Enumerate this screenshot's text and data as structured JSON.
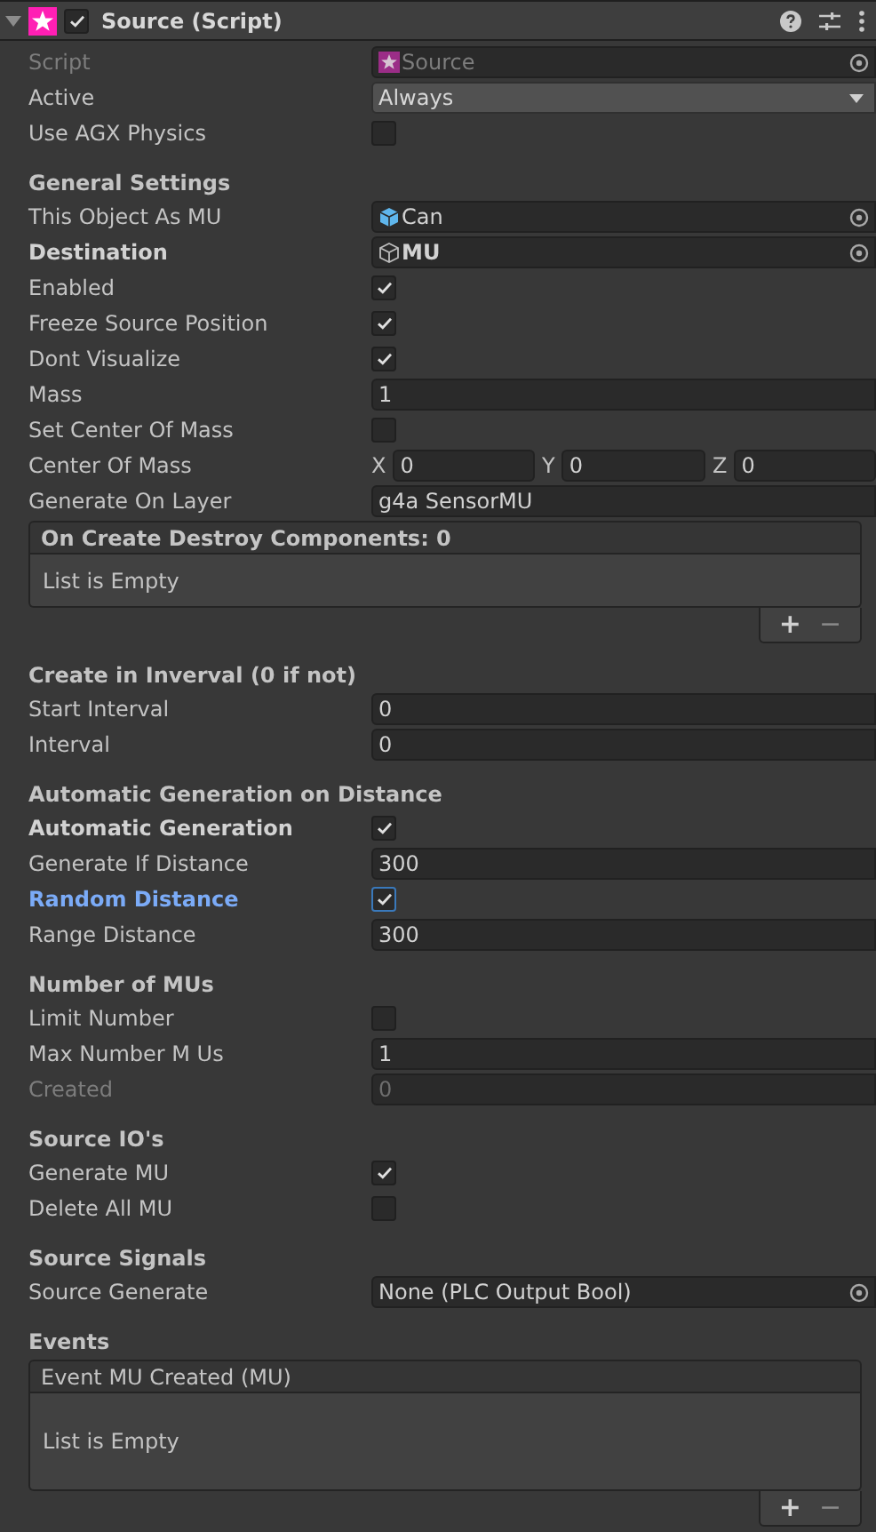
{
  "header": {
    "title": "Source (Script)",
    "expanded": true,
    "enabled": true
  },
  "groups": [
    {
      "rows": [
        {
          "kind": "script",
          "label": "Script",
          "disabled": true,
          "overridden": false,
          "focused": false,
          "value": "Source"
        },
        {
          "kind": "dropdown",
          "label": "Active",
          "disabled": false,
          "overridden": false,
          "focused": false,
          "value": "Always"
        },
        {
          "kind": "checkbox",
          "label": "Use AGX Physics",
          "disabled": false,
          "overridden": false,
          "focused": false,
          "checked": false
        }
      ]
    },
    {
      "heading": "General Settings",
      "rows": [
        {
          "kind": "prefab",
          "label": "This Object As MU",
          "disabled": false,
          "overridden": false,
          "focused": false,
          "value": "Can"
        },
        {
          "kind": "gameobject",
          "label": "Destination",
          "disabled": false,
          "overridden": true,
          "focused": false,
          "value": "MU"
        },
        {
          "kind": "checkbox",
          "label": "Enabled",
          "disabled": false,
          "overridden": false,
          "focused": false,
          "checked": true
        },
        {
          "kind": "checkbox",
          "label": "Freeze Source Position",
          "disabled": false,
          "overridden": false,
          "focused": false,
          "checked": true
        },
        {
          "kind": "checkbox",
          "label": "Dont Visualize",
          "disabled": false,
          "overridden": false,
          "focused": false,
          "checked": true
        },
        {
          "kind": "text",
          "label": "Mass",
          "disabled": false,
          "overridden": false,
          "focused": false,
          "value": "1"
        },
        {
          "kind": "checkbox",
          "label": "Set Center Of Mass",
          "disabled": false,
          "overridden": false,
          "focused": false,
          "checked": false
        },
        {
          "kind": "vector",
          "label": "Center Of Mass",
          "disabled": false,
          "overridden": false,
          "focused": false,
          "axes": [
            {
              "name": "X",
              "value": "0"
            },
            {
              "name": "Y",
              "value": "0"
            },
            {
              "name": "Z",
              "value": "0"
            }
          ]
        },
        {
          "kind": "text",
          "label": "Generate On Layer",
          "disabled": false,
          "overridden": false,
          "focused": false,
          "value": "g4a SensorMU"
        },
        {
          "kind": "list",
          "title": "On Create Destroy Components: 0",
          "empty": "List is Empty",
          "add": "+",
          "remove": "−"
        }
      ]
    },
    {
      "heading": "Create in Inverval (0 if not)",
      "rows": [
        {
          "kind": "text",
          "label": "Start Interval",
          "disabled": false,
          "overridden": false,
          "focused": false,
          "value": "0"
        },
        {
          "kind": "text",
          "label": "Interval",
          "disabled": false,
          "overridden": false,
          "focused": false,
          "value": "0"
        }
      ]
    },
    {
      "heading": "Automatic Generation on Distance",
      "rows": [
        {
          "kind": "checkbox",
          "label": "Automatic Generation",
          "disabled": false,
          "overridden": true,
          "focused": false,
          "checked": true
        },
        {
          "kind": "text",
          "label": "Generate If Distance",
          "disabled": false,
          "overridden": false,
          "focused": false,
          "value": "300"
        },
        {
          "kind": "checkbox",
          "label": "Random Distance",
          "disabled": false,
          "overridden": false,
          "focused": true,
          "checked": true
        },
        {
          "kind": "text",
          "label": "Range Distance",
          "disabled": false,
          "overridden": false,
          "focused": false,
          "value": "300"
        }
      ]
    },
    {
      "heading": "Number of MUs",
      "rows": [
        {
          "kind": "checkbox",
          "label": "Limit Number",
          "disabled": false,
          "overridden": false,
          "focused": false,
          "checked": false
        },
        {
          "kind": "text",
          "label": "Max Number M Us",
          "disabled": false,
          "overridden": false,
          "focused": false,
          "value": "1"
        },
        {
          "kind": "text",
          "label": "Created",
          "disabled": true,
          "overridden": false,
          "focused": false,
          "value": "0"
        }
      ]
    },
    {
      "heading": "Source IO's",
      "rows": [
        {
          "kind": "checkbox",
          "label": "Generate MU",
          "disabled": false,
          "overridden": false,
          "focused": false,
          "checked": true
        },
        {
          "kind": "checkbox",
          "label": "Delete All MU",
          "disabled": false,
          "overridden": false,
          "focused": false,
          "checked": false
        }
      ]
    },
    {
      "heading": "Source Signals",
      "rows": [
        {
          "kind": "reference",
          "label": "Source Generate",
          "disabled": false,
          "overridden": false,
          "focused": false,
          "value": "None (PLC Output Bool)"
        }
      ]
    },
    {
      "heading": "Events",
      "rows": [
        {
          "kind": "event",
          "title": "Event MU Created (MU)",
          "empty": "List is Empty",
          "add": "+",
          "remove": "−"
        }
      ]
    }
  ]
}
